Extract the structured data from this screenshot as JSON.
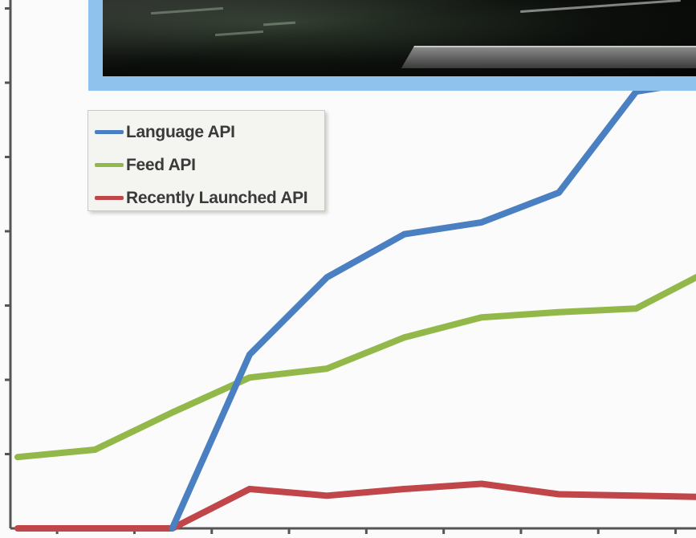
{
  "chart_data": {
    "type": "line",
    "x": [
      0,
      1,
      2,
      3,
      4,
      5,
      6,
      7,
      8,
      9
    ],
    "xlabel": "",
    "ylabel": "",
    "ylim": [
      0,
      7
    ],
    "grid": false,
    "legend_position": "top-left",
    "series": [
      {
        "name": "Language API",
        "color": "#4a7fc1",
        "values": [
          null,
          null,
          0.0,
          2.34,
          3.38,
          3.96,
          4.12,
          4.52,
          5.88,
          6.05
        ]
      },
      {
        "name": "Feed API",
        "color": "#93b84a",
        "values": [
          0.96,
          1.06,
          1.56,
          2.03,
          2.15,
          2.57,
          2.84,
          2.91,
          2.96,
          3.5
        ]
      },
      {
        "name": "Recently Launched API",
        "color": "#c0464a",
        "values": [
          0.0,
          0.0,
          0.0,
          0.53,
          0.44,
          0.53,
          0.6,
          0.46,
          0.44,
          0.42
        ]
      }
    ]
  },
  "icons": {
    "background_photo": "photo-image"
  }
}
